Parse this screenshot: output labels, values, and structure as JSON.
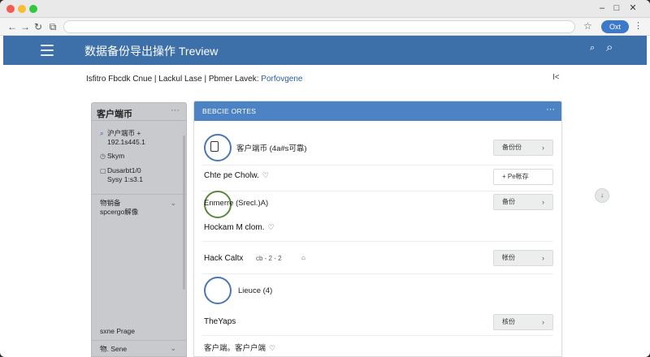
{
  "browser": {
    "window_controls": {
      "minimize": "–",
      "maximize": "□",
      "close": "✕"
    },
    "profile_label": "Oxt"
  },
  "app": {
    "title": "数据备份导出操作 Treview"
  },
  "breadcrumb": {
    "text": "Isfitro Fbcdk Cnue | Lackul Lase | Pbmer Lavek:",
    "link": "Porfovgene",
    "close": "I<"
  },
  "sidebar": {
    "title": "客户端币",
    "more": "···",
    "items": [
      {
        "line1": "沪户端币 +",
        "line2": "192.1s445.1"
      },
      {
        "line1": "Skym",
        "line2": ""
      },
      {
        "line1": "Dusarbt1/0",
        "line2": "Sysy 1:s3.1"
      },
      {
        "line1": "物销备",
        "line2": "spcergo解像"
      },
      {
        "line1": "sxne Prage",
        "line2": ""
      },
      {
        "line1": "物. Sene",
        "line2": ""
      }
    ]
  },
  "main": {
    "title": "BEBCIE ORTES",
    "more": "···",
    "rows": [
      {
        "label": "客户端币 (4a#s可靠)",
        "button": "备份份"
      },
      {
        "label": "Chte pe Cholw.",
        "button": "+ Pe帐存"
      },
      {
        "label": "Enmerre (Srecl.)A)",
        "button": "备份"
      },
      {
        "label": "Hockam M clom.",
        "button": ""
      },
      {
        "label": "Hack Caltx",
        "sub": "cb - 2 - 2",
        "button": "帐份"
      },
      {
        "label": "Lieuce (4)",
        "button": ""
      },
      {
        "label": "TheYaps",
        "button": "核份"
      },
      {
        "label": "客户端。客户户端",
        "button": ""
      }
    ]
  },
  "fab": {
    "label": "↓"
  }
}
